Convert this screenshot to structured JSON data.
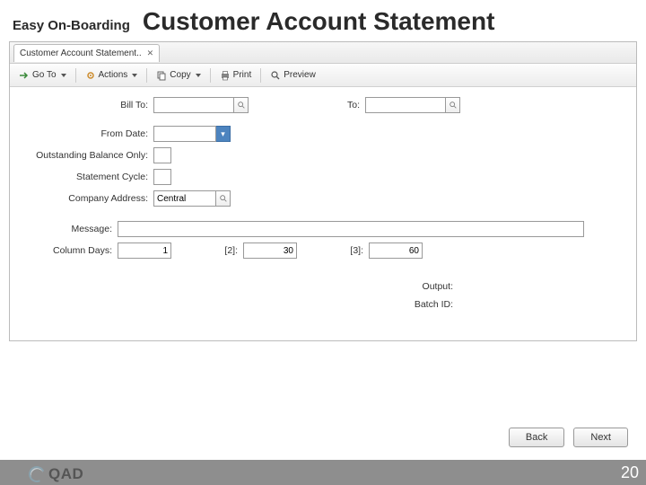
{
  "slide": {
    "subheader": "Easy On-Boarding",
    "title": "Customer Account Statement",
    "page_number": "20",
    "brand": "QAD"
  },
  "window": {
    "tab_title": "Customer Account Statement..",
    "toolbar": {
      "goto": "Go To",
      "actions": "Actions",
      "copy": "Copy",
      "print": "Print",
      "preview": "Preview"
    }
  },
  "form": {
    "bill_to_label": "Bill To:",
    "bill_to_value": "",
    "to_label": "To:",
    "to_value": "",
    "from_date_label": "From Date:",
    "from_date_value": "",
    "outstanding_label": "Outstanding Balance Only:",
    "statement_cycle_label": "Statement Cycle:",
    "statement_cycle_value": "",
    "company_address_label": "Company Address:",
    "company_address_value": "Central",
    "message_label": "Message:",
    "message_value": "",
    "column_days_label": "Column Days:",
    "col1": "1",
    "col2_label": "[2]:",
    "col2": "30",
    "col3_label": "[3]:",
    "col3": "60",
    "output_label": "Output:",
    "output_value": "",
    "batch_label": "Batch ID:",
    "batch_value": ""
  },
  "nav": {
    "back": "Back",
    "next": "Next"
  }
}
